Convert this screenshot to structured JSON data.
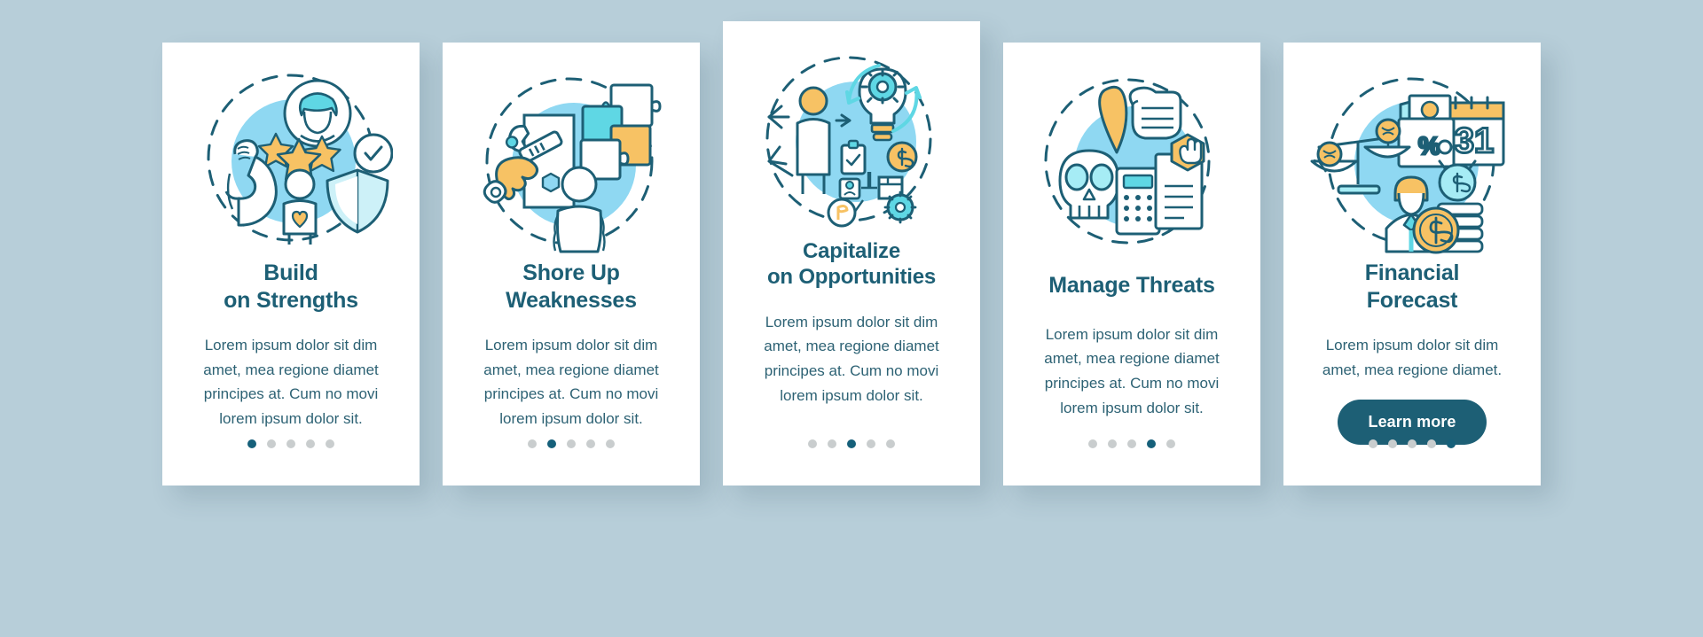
{
  "palette": {
    "page_background": "#b7ced9",
    "card_background": "#ffffff",
    "title_color": "#1d5f75",
    "body_color": "#2d6274",
    "accent_dark_teal": "#1d5f75",
    "illustration_blob": "#8fd8f2",
    "illustration_line": "#1d5f75",
    "illustration_cyan": "#5fd7e4",
    "illustration_yellow": "#f7c264",
    "dot_inactive": "#c9cdce",
    "dot_active": "#16607a",
    "button_background": "#1d5f75",
    "button_text": "#ffffff"
  },
  "cards": [
    {
      "id": "build-on-strengths",
      "title_line1": "Build",
      "title_line2": "on Strengths",
      "body": "Lorem ipsum dolor sit dim amet, mea regione diamet principes at. Cum no movi lorem ipsum dolor sit.",
      "illustration_name": "strength-arm-stars-shield-illustration",
      "dots_total": 5,
      "dots_active_index": 0,
      "has_button": false,
      "button_label": ""
    },
    {
      "id": "shore-up-weaknesses",
      "title_line1": "Shore Up",
      "title_line2": "Weaknesses",
      "body": "Lorem ipsum dolor sit dim amet, mea regione diamet principes at. Cum no movi lorem ipsum dolor sit.",
      "illustration_name": "wrench-puzzle-person-illustration",
      "dots_total": 5,
      "dots_active_index": 1,
      "has_button": false,
      "button_label": ""
    },
    {
      "id": "capitalize-on-opportunities",
      "title_line1": "Capitalize",
      "title_line2": "on Opportunities",
      "body": "Lorem ipsum dolor sit dim amet, mea regione diamet principes at. Cum no movi lorem ipsum dolor sit.",
      "illustration_name": "lightbulb-gears-person-arrows-illustration",
      "dots_total": 5,
      "dots_active_index": 2,
      "has_button": false,
      "button_label": ""
    },
    {
      "id": "manage-threats",
      "title_line1": "Manage Threats",
      "title_line2": "",
      "body": "Lorem ipsum dolor sit dim amet, mea regione diamet principes at. Cum no movi lorem ipsum dolor sit.",
      "illustration_name": "skull-fist-calculator-illustration",
      "dots_total": 5,
      "dots_active_index": 3,
      "has_button": false,
      "button_label": ""
    },
    {
      "id": "financial-forecast",
      "title_line1": "Financial",
      "title_line2": "Forecast",
      "body": "Lorem ipsum dolor sit dim amet, mea regione diamet.",
      "illustration_name": "scales-coins-calendar-businessman-illustration",
      "dots_total": 5,
      "dots_active_index": 4,
      "has_button": true,
      "button_label": "Learn more"
    }
  ]
}
